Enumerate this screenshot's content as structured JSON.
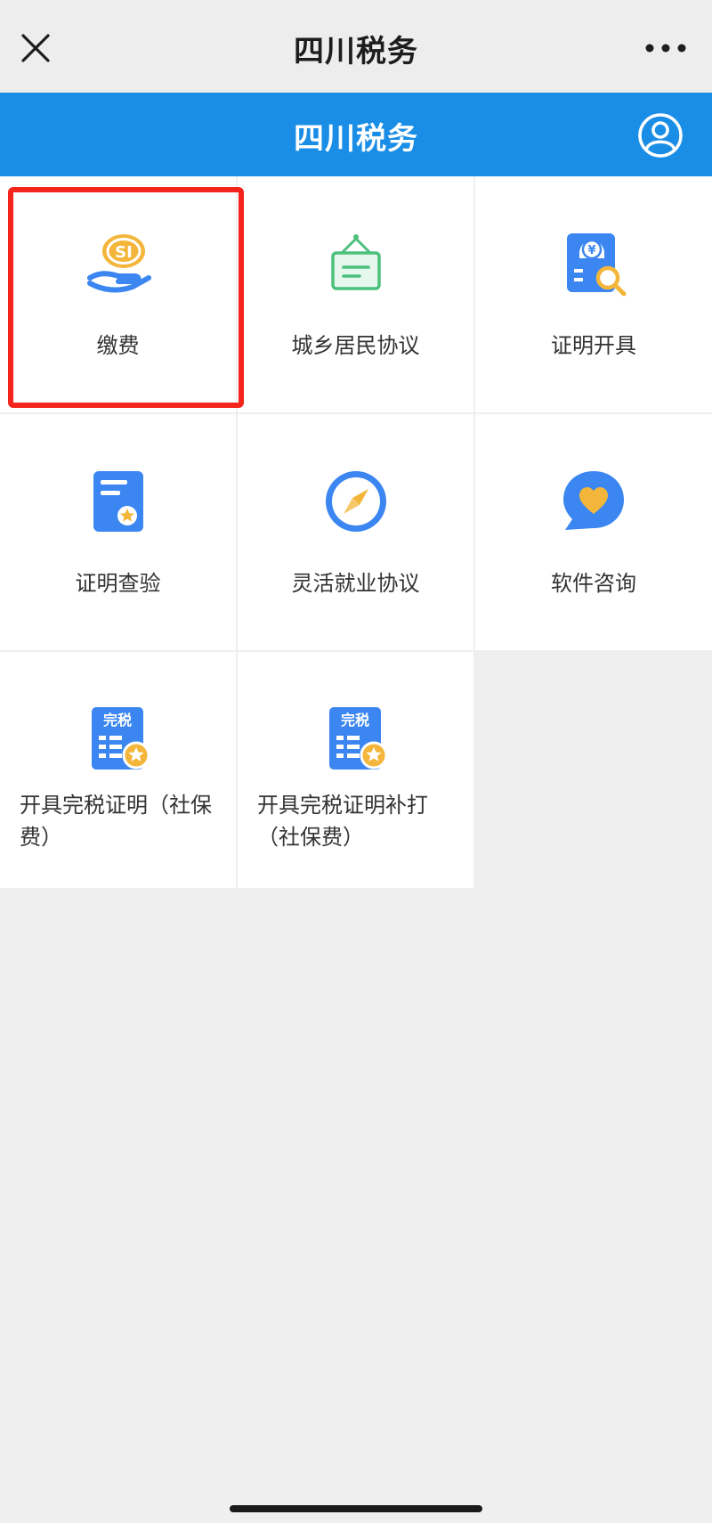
{
  "header": {
    "title": "四川税务",
    "close_icon": "close-icon",
    "more_icon": "more-dots-icon"
  },
  "banner": {
    "title": "四川税务",
    "user_icon": "user-profile-icon",
    "color": "#1a8ee6"
  },
  "services": [
    {
      "label": "缴费",
      "icon": "social-insurance-payment-icon"
    },
    {
      "label": "城乡居民协议",
      "icon": "signboard-icon"
    },
    {
      "label": "证明开具",
      "icon": "certificate-search-icon"
    },
    {
      "label": "证明查验",
      "icon": "document-star-icon"
    },
    {
      "label": "灵活就业协议",
      "icon": "compass-icon"
    },
    {
      "label": "软件咨询",
      "icon": "chat-heart-icon"
    },
    {
      "label": "开具完税证明（社保费）",
      "icon": "tax-certificate-icon",
      "icon_text": "完税"
    },
    {
      "label": "开具完税证明补打（社保费）",
      "icon": "tax-certificate-reprint-icon",
      "icon_text": "完税"
    }
  ],
  "highlight_color": "#f4241c"
}
